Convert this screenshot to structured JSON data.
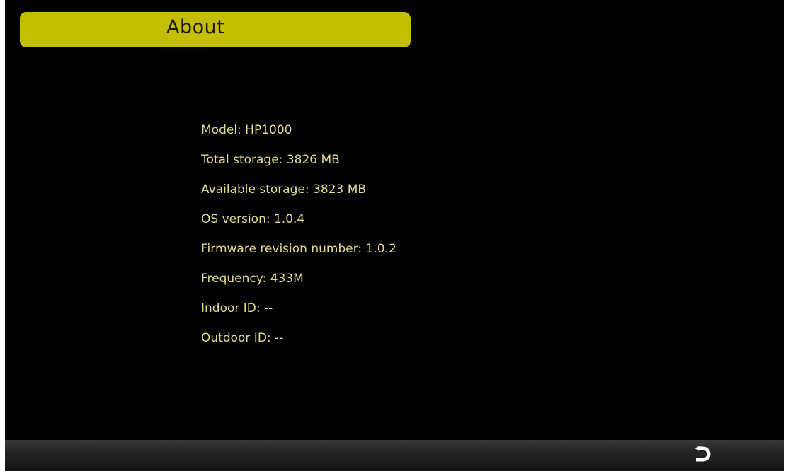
{
  "header": {
    "title": "About"
  },
  "info": [
    {
      "label": "Model: HP1000"
    },
    {
      "label": "Total storage: 3826 MB"
    },
    {
      "label": "Available storage: 3823 MB"
    },
    {
      "label": "OS version: 1.0.4"
    },
    {
      "label": "Firmware revision number: 1.0.2"
    },
    {
      "label": "Frequency: 433M"
    },
    {
      "label": "Indoor ID: --"
    },
    {
      "label": "Outdoor ID: --"
    }
  ],
  "footer": {
    "back_icon": "back-arrow-icon"
  },
  "colors": {
    "background": "#000000",
    "title_bar": "#c4bd00",
    "info_text": "#e0dc8a",
    "bottom_bar": "#262626",
    "back_icon": "#ffffff"
  }
}
